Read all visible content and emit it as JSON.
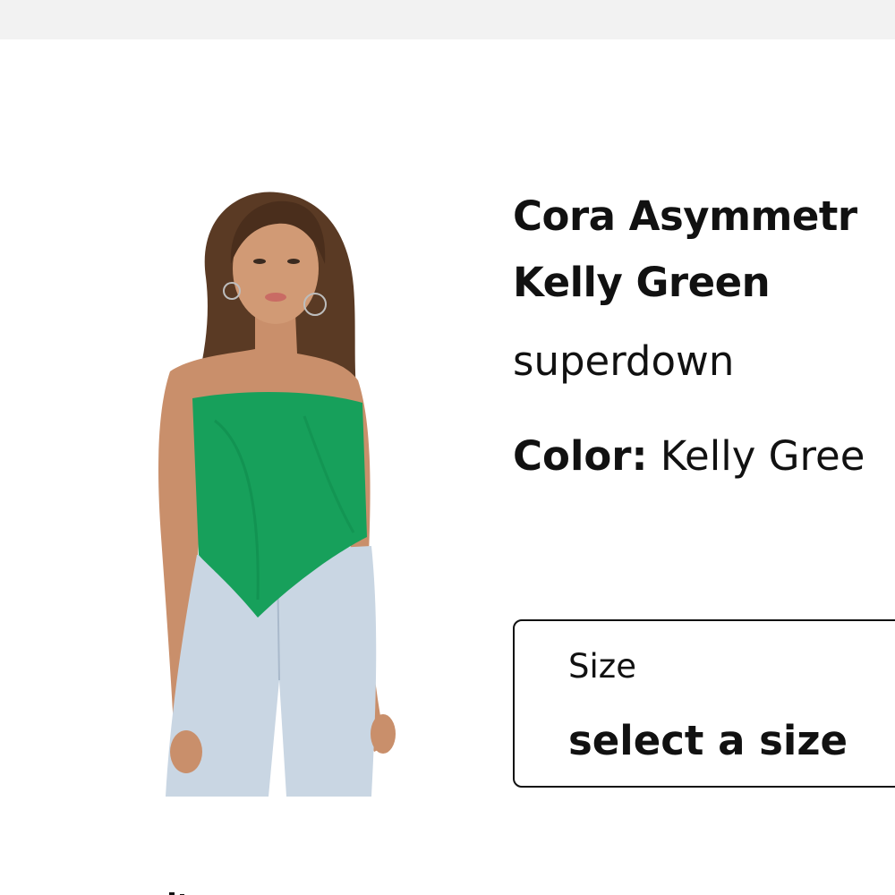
{
  "product": {
    "title_line1": "Cora Asymmetr",
    "title_line2": "Kelly Green",
    "brand": "superdown",
    "color_label": "Color:",
    "color_value": "Kelly Gree",
    "image_alt": "Model wearing strapless green asymmetrical top and light wash jeans"
  },
  "size_selector": {
    "label": "Size",
    "value": "select a size"
  },
  "colors": {
    "topbar": "#f2f2f2",
    "product_green": "#17a05b",
    "denim": "#c9d6e3"
  }
}
